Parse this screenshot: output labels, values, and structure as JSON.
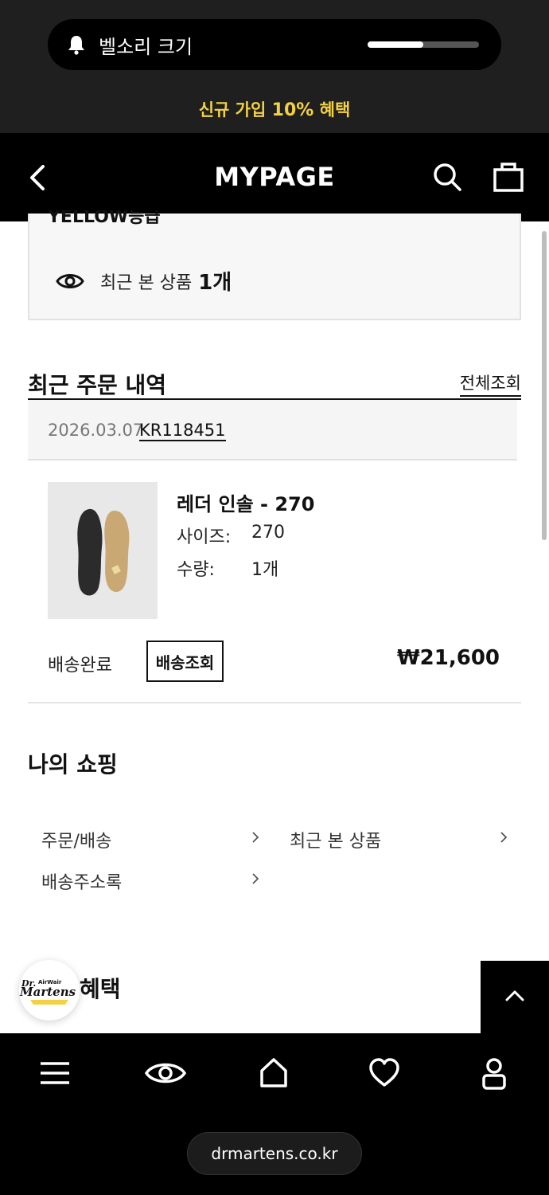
{
  "hud": {
    "label": "벨소리 크기",
    "volume_percent": 50
  },
  "promo": {
    "prefix": "신규 가입 ",
    "highlight": "10%",
    "suffix": " 혜택"
  },
  "header": {
    "title": "MYPAGE"
  },
  "recent": {
    "label": "최근 본 상품",
    "count": "1개",
    "clipped_text": "YELLOW등급"
  },
  "orders": {
    "title": "최근 주문 내역",
    "view_all": "전체조회",
    "date": "2026.03.07",
    "number": "KR118451",
    "item": {
      "name": "레더 인솔 - 270",
      "size_label": "사이즈:",
      "size_value": "270",
      "qty_label": "수량:",
      "qty_value": "1개",
      "status": "배송완료",
      "track_label": "배송조회",
      "price": "₩21,600"
    }
  },
  "my_shopping": {
    "title": "나의 쇼핑",
    "items": [
      {
        "label": "주문/배송"
      },
      {
        "label": "최근 본 상품"
      },
      {
        "label": "배송주소록"
      }
    ]
  },
  "benefit": {
    "title_partial": "혜택"
  },
  "logo": {
    "text": "Dr. Martens"
  },
  "bottom_nav": {
    "url": "drmartens.co.kr"
  },
  "colors": {
    "promo_yellow": "#f3d142",
    "hud_bg": "#000000"
  }
}
